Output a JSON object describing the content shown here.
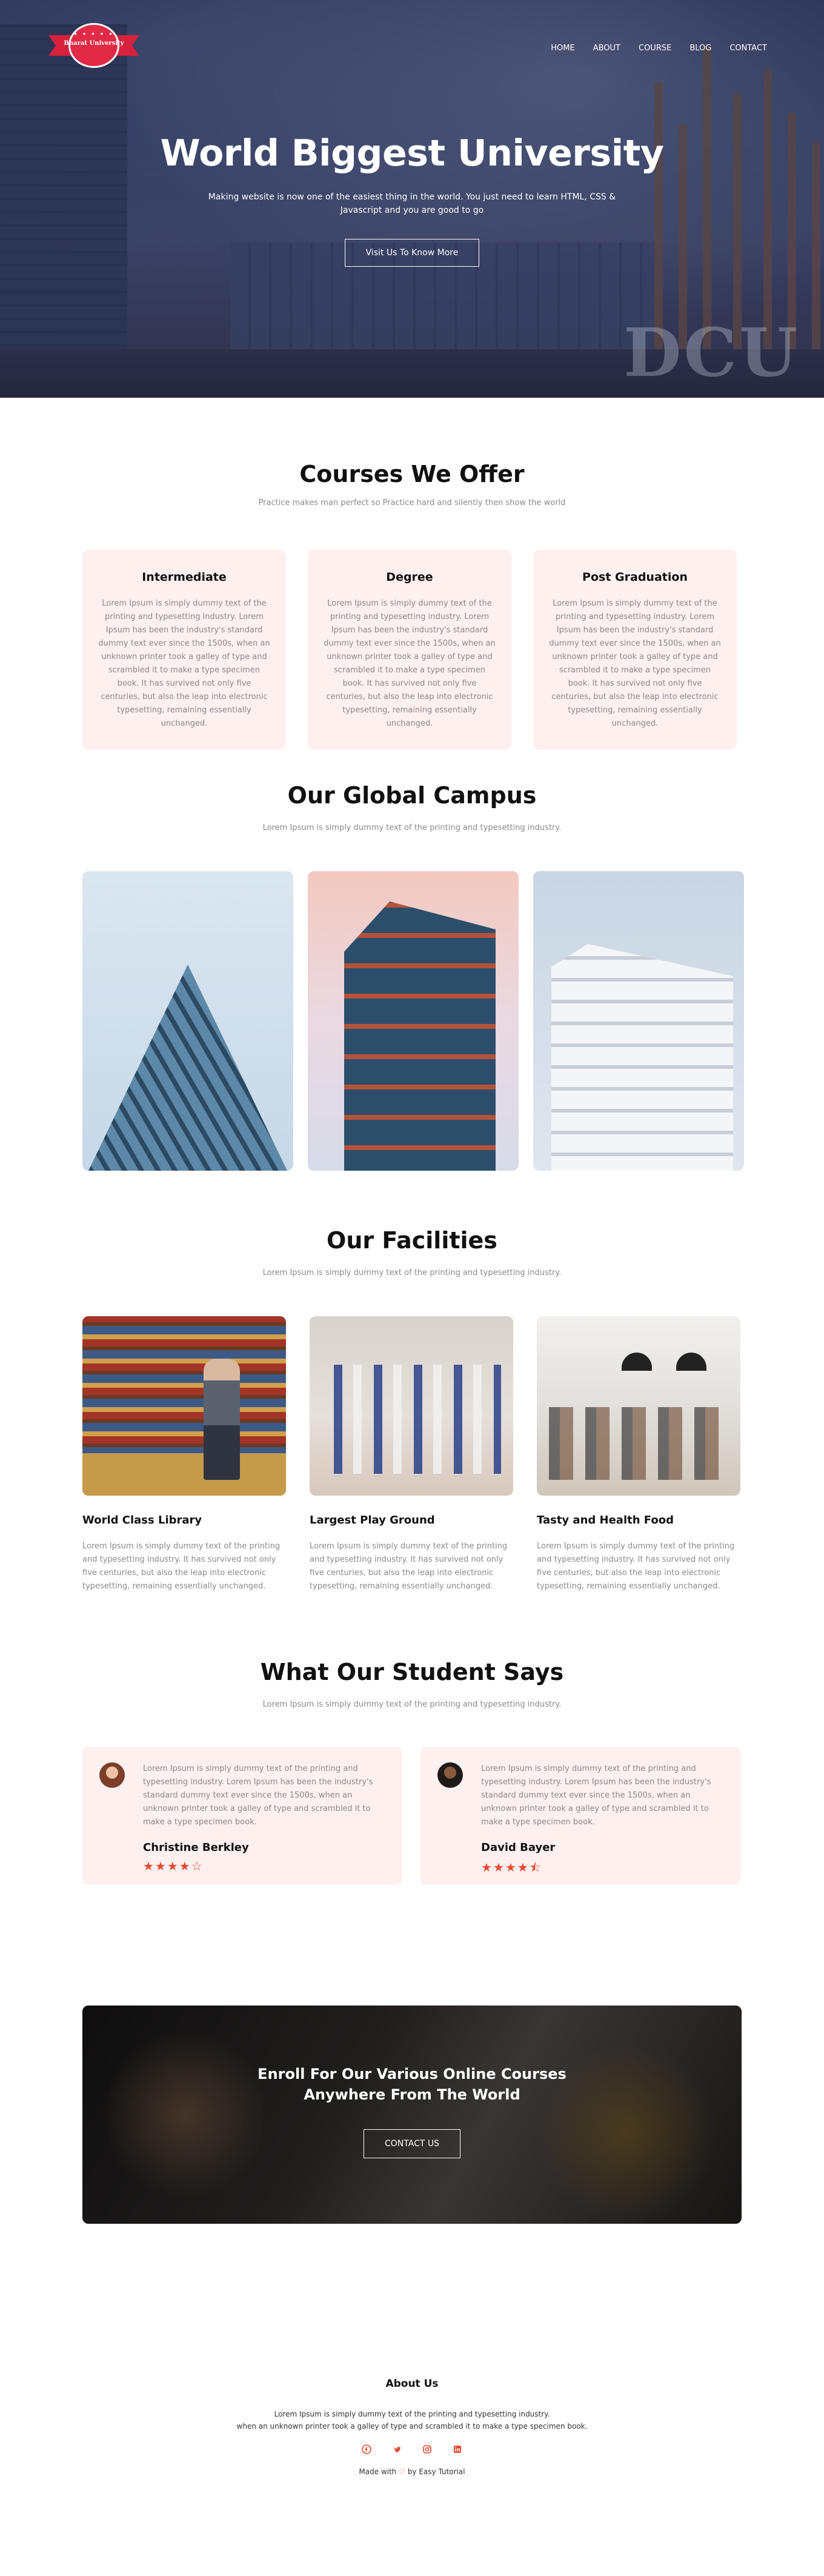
{
  "nav": {
    "logo_text": "Bharat University",
    "links": [
      "HOME",
      "ABOUT",
      "COURSE",
      "BLOG",
      "CONTACT"
    ]
  },
  "hero": {
    "title": "World Biggest University",
    "description": "Making website is now one of the easiest thing in the world. You just need to learn HTML, CSS & Javascript and you are good to go",
    "button_label": "Visit Us To Know More",
    "watermark": "DCU"
  },
  "courses": {
    "title": "Courses We Offer",
    "subtitle": "Practice makes man perfect so Practice hard and silently then show the world",
    "items": [
      {
        "name": "Intermediate",
        "text": "Lorem Ipsum is simply dummy text of the printing and typesetting industry. Lorem Ipsum has been the industry's standard dummy text ever since the 1500s, when an unknown printer took a galley of type and scrambled it to make a type specimen book. It has survived not only five centuries, but also the leap into electronic typesetting, remaining essentially unchanged."
      },
      {
        "name": "Degree",
        "text": "Lorem Ipsum is simply dummy text of the printing and typesetting industry. Lorem Ipsum has been the industry's standard dummy text ever since the 1500s, when an unknown printer took a galley of type and scrambled it to make a type specimen book. It has survived not only five centuries, but also the leap into electronic typesetting, remaining essentially unchanged."
      },
      {
        "name": "Post Graduation",
        "text": "Lorem Ipsum is simply dummy text of the printing and typesetting industry. Lorem Ipsum has been the industry's standard dummy text ever since the 1500s, when an unknown printer took a galley of type and scrambled it to make a type specimen book. It has survived not only five centuries, but also the leap into electronic typesetting, remaining essentially unchanged."
      }
    ]
  },
  "campus": {
    "title": "Our Global Campus",
    "subtitle": "Lorem Ipsum is simply dummy text of the printing and typesetting industry."
  },
  "facilities": {
    "title": "Our Facilities",
    "subtitle": "Lorem Ipsum is simply dummy text of the printing and typesetting industry.",
    "items": [
      {
        "name": "World Class Library",
        "text": "Lorem Ipsum is simply dummy text of the printing and typesetting industry. It has survived not only five centuries, but also the leap into electronic typesetting, remaining essentially unchanged."
      },
      {
        "name": "Largest Play Ground",
        "text": "Lorem Ipsum is simply dummy text of the printing and typesetting industry. It has survived not only five centuries, but also the leap into electronic typesetting, remaining essentially unchanged."
      },
      {
        "name": "Tasty and Health Food",
        "text": "Lorem Ipsum is simply dummy text of the printing and typesetting industry. It has survived not only five centuries, but also the leap into electronic typesetting, remaining essentially unchanged."
      }
    ]
  },
  "testimonials": {
    "title": "What Our Student Says",
    "subtitle": "Lorem Ipsum is simply dummy text of the printing and typesetting industry.",
    "items": [
      {
        "name": "Christine Berkley",
        "text": "Lorem Ipsum is simply dummy text of the printing and typesetting industry. Lorem Ipsum has been the industry's standard dummy text ever since the 1500s, when an unknown printer took a galley of type and scrambled it to make a type specimen book.",
        "rating": 4,
        "stars": "★★★★☆"
      },
      {
        "name": "David Bayer",
        "text": "Lorem Ipsum is simply dummy text of the printing and typesetting industry. Lorem Ipsum has been the industry's standard dummy text ever since the 1500s, when an unknown printer took a galley of type and scrambled it to make a type specimen book.",
        "rating": 4.5,
        "stars": "★★★★⯪"
      }
    ]
  },
  "cta": {
    "title_line1": "Enroll For Our Various Online Courses",
    "title_line2": "Anywhere From The World",
    "button_label": "CONTACT US"
  },
  "footer": {
    "title": "About Us",
    "about_line1": "Lorem Ipsum is simply dummy text of the printing and typesetting industry.",
    "about_line2": "when an unknown printer took a galley of type and scrambled it to make a type specimen book.",
    "social_icons": [
      "facebook-icon",
      "twitter-icon",
      "instagram-icon",
      "linkedin-icon"
    ],
    "made_prefix": "Made with",
    "made_suffix": "by Easy Tutorial"
  },
  "colors": {
    "accent": "#e8472f",
    "card_bg": "#fdf0ef",
    "logo_red": "#d8213d"
  }
}
